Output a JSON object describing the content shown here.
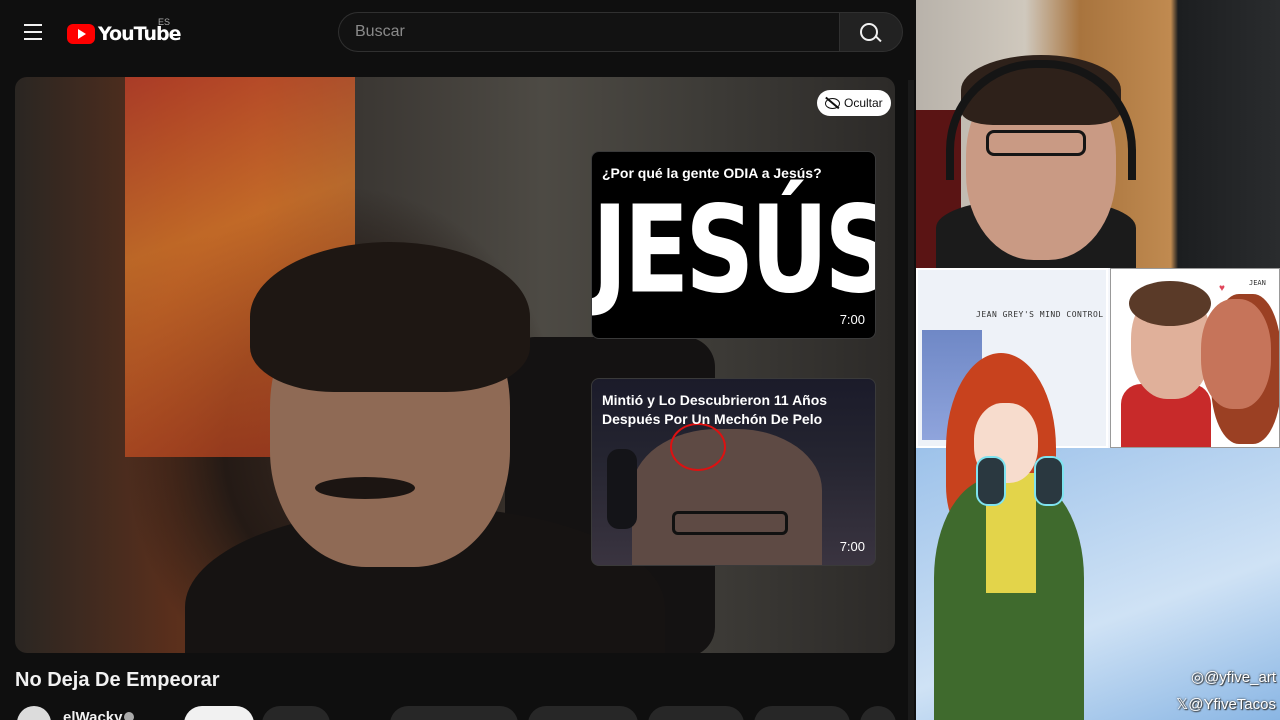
{
  "youtube": {
    "logo_text": "YouTube",
    "country_code": "ES",
    "search": {
      "placeholder": "Buscar"
    }
  },
  "player": {
    "hide_label": "Ocultar",
    "end_cards": [
      {
        "title": "¿Por qué la gente ODIA a Jesús?",
        "thumbnail_text": "JESÚS",
        "duration": "7:00"
      },
      {
        "title": "Mintió y Lo Descubrieron 11 Años Después Por Un Mechón De Pelo",
        "duration": "7:00"
      }
    ]
  },
  "video": {
    "title": "No Deja De Empeorar",
    "channel": "elWacky"
  },
  "overlay_art": {
    "caption": "JEAN GREY'S MIND CONTROL",
    "side_label": "JEAN",
    "instagram": "@yfive_art",
    "x_handle": "@YfiveTacos"
  },
  "colors": {
    "brand_red": "#ff0000",
    "background": "#0f0f0f"
  }
}
